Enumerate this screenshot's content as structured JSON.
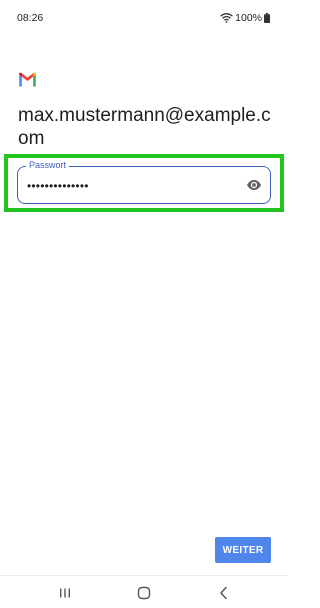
{
  "status_bar": {
    "time": "08:26",
    "battery_percent": "100%",
    "icons": [
      "wifi-icon",
      "battery-icon"
    ]
  },
  "app": {
    "logo": "gmail-logo",
    "colors": {
      "red": "#ea4335",
      "blue": "#4285f4",
      "green": "#34a853",
      "yellow": "#fbbc04"
    }
  },
  "account": {
    "email": "max.mustermann@example.com"
  },
  "password_field": {
    "label": "Passwort",
    "value": "••••••••••••••",
    "toggle_icon": "eye-icon",
    "accent_color": "#3b62c4"
  },
  "highlight": {
    "color": "#22c51f"
  },
  "actions": {
    "next_label": "WEITER",
    "next_color": "#4f86ec"
  },
  "navigation": {
    "icons": [
      "recent-apps-icon",
      "home-icon",
      "back-icon"
    ]
  }
}
